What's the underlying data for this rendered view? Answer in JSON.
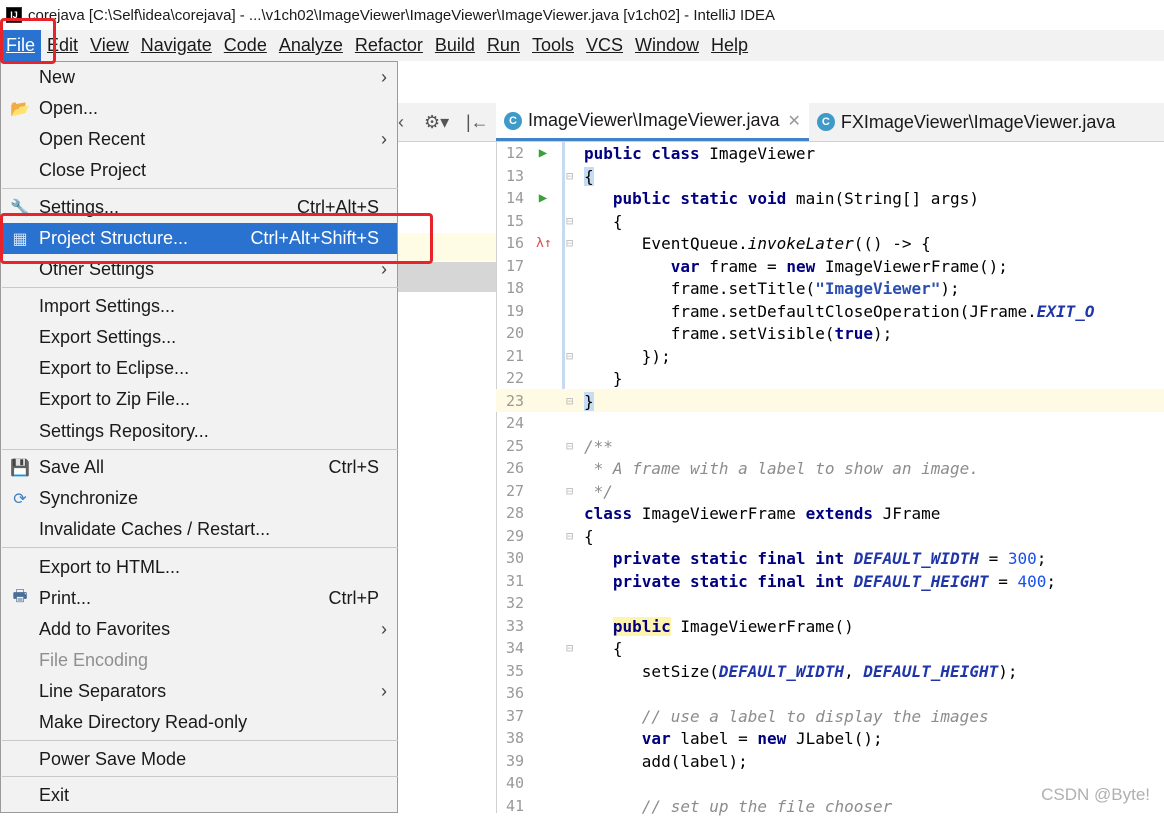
{
  "window": {
    "title": "corejava [C:\\Self\\idea\\corejava] - ...\\v1ch02\\ImageViewer\\ImageViewer\\ImageViewer.java [v1ch02] - IntelliJ IDEA",
    "app_icon": "IJ"
  },
  "menubar": {
    "items": [
      "File",
      "Edit",
      "View",
      "Navigate",
      "Code",
      "Analyze",
      "Refactor",
      "Build",
      "Run",
      "Tools",
      "VCS",
      "Window",
      "Help"
    ]
  },
  "tabs": [
    {
      "label": "ImageViewer\\ImageViewer.java",
      "icon": "C",
      "active": true
    },
    {
      "label": "FXImageViewer\\ImageViewer.java",
      "icon": "C",
      "active": false
    }
  ],
  "file_menu": {
    "items": [
      {
        "label": "New",
        "shortcut": "",
        "submenu": true
      },
      {
        "label": "Open...",
        "shortcut": "",
        "icon": "folder-icon"
      },
      {
        "label": "Open Recent",
        "shortcut": "",
        "submenu": true
      },
      {
        "label": "Close Project",
        "shortcut": ""
      },
      {
        "label": "Settings...",
        "shortcut": "Ctrl+Alt+S",
        "icon": "wrench-icon"
      },
      {
        "label": "Project Structure...",
        "shortcut": "Ctrl+Alt+Shift+S",
        "icon": "project-structure-icon",
        "selected": true
      },
      {
        "label": "Other Settings",
        "shortcut": "",
        "submenu": true
      },
      {
        "label": "Import Settings...",
        "shortcut": ""
      },
      {
        "label": "Export Settings...",
        "shortcut": ""
      },
      {
        "label": "Export to Eclipse...",
        "shortcut": ""
      },
      {
        "label": "Export to Zip File...",
        "shortcut": ""
      },
      {
        "label": "Settings Repository...",
        "shortcut": ""
      },
      {
        "label": "Save All",
        "shortcut": "Ctrl+S",
        "icon": "save-icon"
      },
      {
        "label": "Synchronize",
        "shortcut": "",
        "icon": "sync-icon"
      },
      {
        "label": "Invalidate Caches / Restart...",
        "shortcut": ""
      },
      {
        "label": "Export to HTML...",
        "shortcut": ""
      },
      {
        "label": "Print...",
        "shortcut": "Ctrl+P",
        "icon": "print-icon"
      },
      {
        "label": "Add to Favorites",
        "shortcut": "",
        "submenu": true
      },
      {
        "label": "File Encoding",
        "shortcut": "",
        "disabled": true
      },
      {
        "label": "Line Separators",
        "shortcut": "",
        "submenu": true
      },
      {
        "label": "Make Directory Read-only",
        "shortcut": ""
      },
      {
        "label": "Power Save Mode",
        "shortcut": ""
      },
      {
        "label": "Exit",
        "shortcut": ""
      }
    ]
  },
  "editor": {
    "line_numbers": [
      "12",
      "13",
      "14",
      "15",
      "16",
      "17",
      "18",
      "19",
      "20",
      "21",
      "22",
      "23",
      "24",
      "25",
      "26",
      "27",
      "28",
      "29",
      "30",
      "31",
      "32",
      "33",
      "34",
      "35",
      "36",
      "37",
      "38",
      "39",
      "40",
      "41"
    ]
  },
  "watermark": "CSDN @Byte!"
}
